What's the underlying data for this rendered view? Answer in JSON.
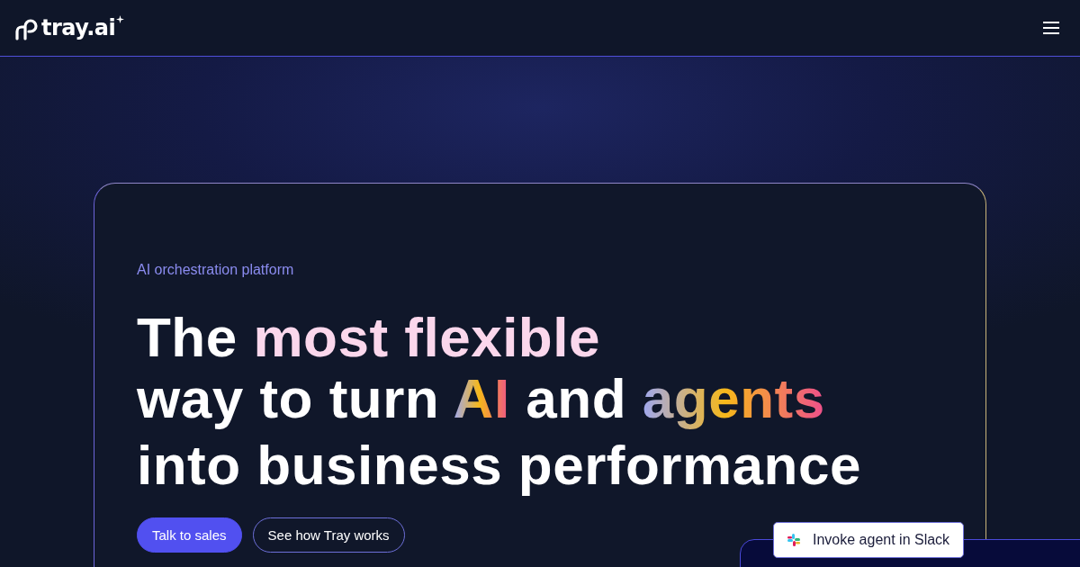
{
  "header": {
    "logo": "tray.ai"
  },
  "hero": {
    "eyebrow": "AI orchestration platform",
    "headline": [
      [
        {
          "text": "The ",
          "kind": "plain"
        },
        {
          "text": "most flexible",
          "kind": "soft"
        }
      ],
      [
        {
          "text": "way to turn ",
          "kind": "plain"
        },
        {
          "text": "AI",
          "kind": "gradient"
        },
        {
          "text": " and ",
          "kind": "plain"
        },
        {
          "text": "agents",
          "kind": "gradient"
        }
      ],
      [
        {
          "text": "into business performance",
          "kind": "plain"
        }
      ]
    ],
    "buttons": [
      {
        "label": "Talk to sales",
        "kind": "primary"
      },
      {
        "label": "See how Tray works",
        "kind": "outline"
      }
    ]
  },
  "slack_chip": {
    "label": "Invoke agent in Slack"
  }
}
